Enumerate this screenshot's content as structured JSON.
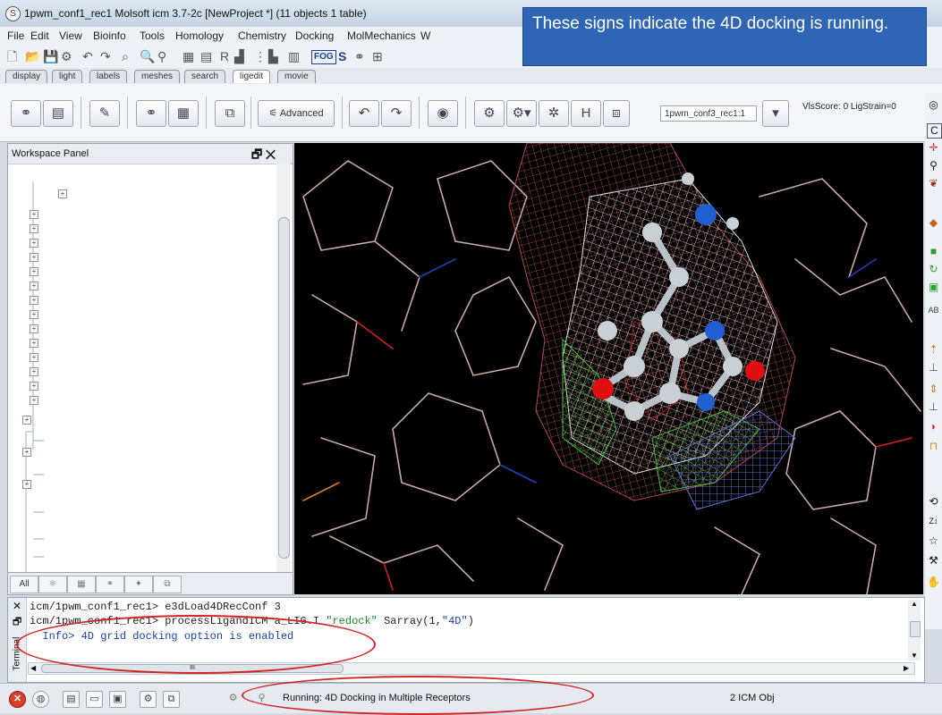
{
  "window": {
    "title": "1pwm_conf1_rec1 Molsoft icm 3.7-2c  [NewProject *] (11 objects 1 table)"
  },
  "callout": {
    "text": "These signs indicate the 4D docking is running."
  },
  "menu": [
    "File",
    "Edit",
    "View",
    "Bioinfo",
    "Tools",
    "Homology",
    "Chemistry",
    "Docking",
    "MolMechanics",
    "W"
  ],
  "tabs": [
    "display",
    "light",
    "labels",
    "meshes",
    "search",
    "ligedit",
    "movie"
  ],
  "ligedit": {
    "advanced_label": "Advanced",
    "receptor": "1pwm_conf3_rec1:1",
    "score": "VlsScore: 0 LigStrain=0"
  },
  "workspace": {
    "title": "Workspace Panel",
    "tab_all": "All"
  },
  "terminal": {
    "side_label": "Terminal",
    "lines": [
      "icm/1pwm_conf1_rec1> e3dLoad4DRecConf 3",
      "icm/1pwm_conf1_rec1> processLigandICM a_LIG.I \"redock\" Sarray(1,\"4D\")",
      "  Info> 4D grid docking option is enabled"
    ],
    "line2_prefix": "icm/1pwm_conf1_rec1> processLigandICM a_LIG.I ",
    "line2_string": "\"redock\"",
    "line2_suffix": " Sarray(1,",
    "line2_string2": "\"4D\"",
    "line2_end": ")",
    "scroll_marker": "III"
  },
  "status": {
    "running": "Running: 4D Docking in Multiple Receptors",
    "objects": "2 ICM Obj"
  },
  "colors": {
    "callout": "#2f65b5",
    "annotation_ring": "#d22525",
    "viewer_bg": "#000000"
  }
}
